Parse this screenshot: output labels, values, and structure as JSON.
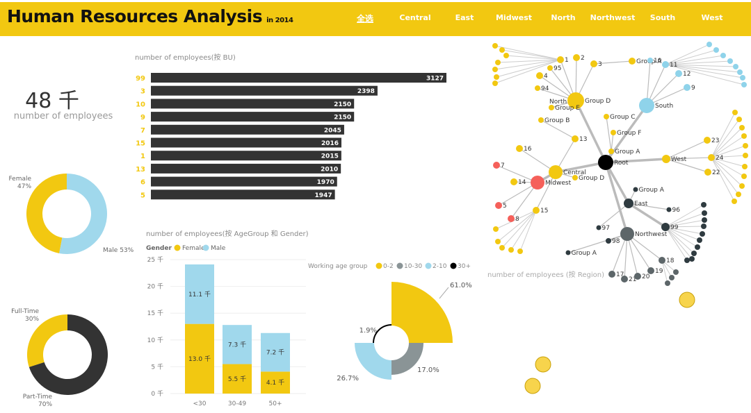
{
  "header": {
    "title": "Human Resources Analysis",
    "subtitle": "in 2014",
    "nav": [
      "全选",
      "Central",
      "East",
      "Midwest",
      "North",
      "Northwest",
      "South",
      "West"
    ],
    "selected": "全选",
    "brand_color": "#f2c811"
  },
  "kpi": {
    "value": "48 千",
    "label": "number of employees"
  },
  "colors": {
    "yellow": "#f2c811",
    "blue": "#a0d8ec",
    "dark": "#333333",
    "gray": "#8a9496",
    "black": "#000000",
    "red": "#f5605a",
    "navy": "#2f3b40",
    "slate": "#5d6669"
  },
  "chart_data": [
    {
      "type": "bar",
      "orientation": "horizontal",
      "title": "number of employees(按 BU)",
      "categories": [
        "99",
        "3",
        "10",
        "9",
        "7",
        "15",
        "1",
        "13",
        "6",
        "5"
      ],
      "values": [
        3127,
        2398,
        2150,
        2150,
        2045,
        2016,
        2015,
        2010,
        1970,
        1947
      ]
    },
    {
      "type": "pie",
      "donut": true,
      "slices": [
        {
          "name": "Female",
          "value": 47,
          "label": "47%"
        },
        {
          "name": "Male",
          "value": 53,
          "label": "53%"
        }
      ]
    },
    {
      "type": "pie",
      "donut": true,
      "slices": [
        {
          "name": "Full-Time",
          "value": 30,
          "label": "30%"
        },
        {
          "name": "Part-Time",
          "value": 70,
          "label": "70%"
        }
      ]
    },
    {
      "type": "bar",
      "stacked": true,
      "title": "number of employees(按 AgeGroup 和 Gender)",
      "legend_title": "Gender",
      "legend_placement": "top-left",
      "categories": [
        "<30",
        "30-49",
        "50+"
      ],
      "series": [
        {
          "name": "Female",
          "values": [
            13.0,
            5.5,
            4.1
          ],
          "labels": [
            "13.0 千",
            "5.5 千",
            "4.1 千"
          ]
        },
        {
          "name": "Male",
          "values": [
            11.1,
            7.3,
            7.2
          ],
          "labels": [
            "11.1 千",
            "7.3 千",
            "7.2 千"
          ]
        }
      ],
      "yticks": [
        "0 千",
        "5 千",
        "10 千",
        "15 千",
        "20 千",
        "25 千"
      ],
      "ylim": [
        0,
        25
      ],
      "grid": true
    },
    {
      "type": "pie",
      "variant": "rose",
      "legend_title": "Working age group",
      "legend_placement": "top",
      "slices": [
        {
          "name": "0-2",
          "value": 61.0,
          "label": "61.0%"
        },
        {
          "name": "10-30",
          "value": 17.0,
          "label": "17.0%"
        },
        {
          "name": "2-10",
          "value": 26.7,
          "label": "26.7%"
        },
        {
          "name": "30+",
          "value": 1.9,
          "label": "1.9%"
        }
      ]
    }
  ],
  "network": {
    "caption": "number of employees (按 Region)",
    "nodes": [
      "Root",
      "Group D",
      "South",
      "West",
      "Central",
      "Midwest",
      "East",
      "Northwest",
      "Group A",
      "Group C",
      "Group F",
      "13",
      "Group B",
      "Group E",
      "16",
      "15",
      "Group D",
      "1",
      "2",
      "3",
      "Group A",
      "95",
      "4",
      "94",
      "10",
      "11",
      "12",
      "9",
      "23",
      "24",
      "22",
      "Group A",
      "96",
      "99",
      "98",
      "97",
      "Group A",
      "18",
      "19",
      "17",
      "21",
      "20",
      "7",
      "5",
      "8",
      "14",
      "North"
    ]
  }
}
